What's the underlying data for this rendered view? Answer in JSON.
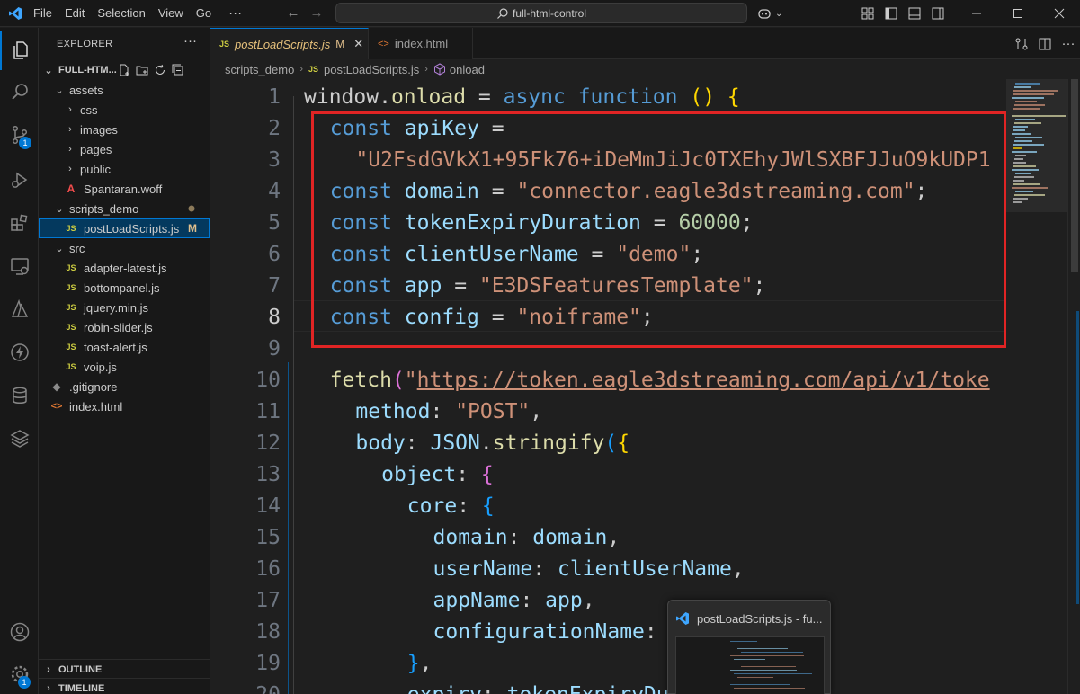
{
  "titlebar": {
    "menu": [
      "File",
      "Edit",
      "Selection",
      "View",
      "Go"
    ],
    "menu_more": "···",
    "search_text": "full-html-control"
  },
  "activitybar": {
    "items": [
      {
        "name": "explorer",
        "badge": ""
      },
      {
        "name": "search",
        "badge": ""
      },
      {
        "name": "source-control",
        "badge": "1"
      },
      {
        "name": "run-debug",
        "badge": ""
      },
      {
        "name": "extensions",
        "badge": ""
      },
      {
        "name": "remote-explorer",
        "badge": ""
      },
      {
        "name": "azure",
        "badge": ""
      },
      {
        "name": "thunder-client",
        "badge": ""
      },
      {
        "name": "database",
        "badge": ""
      },
      {
        "name": "layers",
        "badge": ""
      }
    ],
    "accounts_label": "Accounts",
    "manage_badge": "1"
  },
  "sidebar": {
    "title": "EXPLORER",
    "more": "···",
    "root": "FULL-HTM...",
    "tree": [
      {
        "label": "assets",
        "type": "folder",
        "open": true,
        "indent": 1
      },
      {
        "label": "css",
        "type": "folder",
        "open": false,
        "indent": 2
      },
      {
        "label": "images",
        "type": "folder",
        "open": false,
        "indent": 2
      },
      {
        "label": "pages",
        "type": "folder",
        "open": false,
        "indent": 2
      },
      {
        "label": "public",
        "type": "folder",
        "open": false,
        "indent": 2
      },
      {
        "label": "Spantaran.woff",
        "type": "woff",
        "indent": 2
      },
      {
        "label": "scripts_demo",
        "type": "folder",
        "open": true,
        "indent": 1,
        "status": "dot"
      },
      {
        "label": "postLoadScripts.js",
        "type": "js",
        "indent": 2,
        "status": "M",
        "selected": true
      },
      {
        "label": "src",
        "type": "folder",
        "open": true,
        "indent": 1
      },
      {
        "label": "adapter-latest.js",
        "type": "js",
        "indent": 2
      },
      {
        "label": "bottompanel.js",
        "type": "js",
        "indent": 2
      },
      {
        "label": "jquery.min.js",
        "type": "js",
        "indent": 2
      },
      {
        "label": "robin-slider.js",
        "type": "js",
        "indent": 2
      },
      {
        "label": "toast-alert.js",
        "type": "js",
        "indent": 2
      },
      {
        "label": "voip.js",
        "type": "js",
        "indent": 2
      },
      {
        "label": ".gitignore",
        "type": "git",
        "indent": 1
      },
      {
        "label": "index.html",
        "type": "html",
        "indent": 1
      }
    ],
    "outline": "OUTLINE",
    "timeline": "TIMELINE"
  },
  "tabs": [
    {
      "label": "postLoadScripts.js",
      "icon": "JS",
      "status": "M",
      "active": true
    },
    {
      "label": "index.html",
      "icon": "<>",
      "active": false
    }
  ],
  "breadcrumb": {
    "folder": "scripts_demo",
    "file": "postLoadScripts.js",
    "file_icon": "JS",
    "symbol": "onload"
  },
  "editor": {
    "current_line": 8,
    "lines": [
      {
        "n": "1",
        "indent": 0,
        "tokens": [
          [
            "pl",
            "window"
          ],
          [
            "pl",
            "."
          ],
          [
            "fn",
            "onload"
          ],
          [
            "pl",
            " = "
          ],
          [
            "kw",
            "async"
          ],
          [
            "pl",
            " "
          ],
          [
            "kw",
            "function"
          ],
          [
            "pl",
            " "
          ],
          [
            "br1",
            "()"
          ],
          [
            "pl",
            " "
          ],
          [
            "br1",
            "{"
          ]
        ]
      },
      {
        "n": "2",
        "indent": 1,
        "tokens": [
          [
            "kw",
            "const"
          ],
          [
            "pl",
            " "
          ],
          [
            "var",
            "apiKey"
          ],
          [
            "pl",
            " ="
          ]
        ]
      },
      {
        "n": "3",
        "indent": 2,
        "tokens": [
          [
            "str",
            "\"U2FsdGVkX1+95Fk76+iDeMmJiJc0TXEhyJWlSXBFJJuO9kUDP1"
          ]
        ]
      },
      {
        "n": "4",
        "indent": 1,
        "tokens": [
          [
            "kw",
            "const"
          ],
          [
            "pl",
            " "
          ],
          [
            "var",
            "domain"
          ],
          [
            "pl",
            " = "
          ],
          [
            "str",
            "\"connector.eagle3dstreaming.com\""
          ],
          [
            "pl",
            ";"
          ]
        ]
      },
      {
        "n": "5",
        "indent": 1,
        "tokens": [
          [
            "kw",
            "const"
          ],
          [
            "pl",
            " "
          ],
          [
            "var",
            "tokenExpiryDuration"
          ],
          [
            "pl",
            " = "
          ],
          [
            "num",
            "60000"
          ],
          [
            "pl",
            ";"
          ]
        ]
      },
      {
        "n": "6",
        "indent": 1,
        "tokens": [
          [
            "kw",
            "const"
          ],
          [
            "pl",
            " "
          ],
          [
            "var",
            "clientUserName"
          ],
          [
            "pl",
            " = "
          ],
          [
            "str",
            "\"demo\""
          ],
          [
            "pl",
            ";"
          ]
        ]
      },
      {
        "n": "7",
        "indent": 1,
        "tokens": [
          [
            "kw",
            "const"
          ],
          [
            "pl",
            " "
          ],
          [
            "var",
            "app"
          ],
          [
            "pl",
            " = "
          ],
          [
            "str",
            "\"E3DSFeaturesTemplate\""
          ],
          [
            "pl",
            ";"
          ]
        ]
      },
      {
        "n": "8",
        "indent": 1,
        "tokens": [
          [
            "kw",
            "const"
          ],
          [
            "pl",
            " "
          ],
          [
            "var",
            "config"
          ],
          [
            "pl",
            " = "
          ],
          [
            "str",
            "\"noiframe\""
          ],
          [
            "pl",
            ";"
          ]
        ]
      },
      {
        "n": "9",
        "indent": 0,
        "tokens": []
      },
      {
        "n": "10",
        "indent": 1,
        "tokens": [
          [
            "fn",
            "fetch"
          ],
          [
            "br2",
            "("
          ],
          [
            "str",
            "\""
          ],
          [
            "url",
            "https://token.eagle3dstreaming.com/api/v1/toke"
          ]
        ]
      },
      {
        "n": "11",
        "indent": 2,
        "tokens": [
          [
            "var",
            "method"
          ],
          [
            "pl",
            ": "
          ],
          [
            "str",
            "\"POST\""
          ],
          [
            "pl",
            ","
          ]
        ]
      },
      {
        "n": "12",
        "indent": 2,
        "tokens": [
          [
            "var",
            "body"
          ],
          [
            "pl",
            ": "
          ],
          [
            "var",
            "JSON"
          ],
          [
            "pl",
            "."
          ],
          [
            "fn",
            "stringify"
          ],
          [
            "br3",
            "("
          ],
          [
            "br1",
            "{"
          ]
        ]
      },
      {
        "n": "13",
        "indent": 3,
        "tokens": [
          [
            "var",
            "object"
          ],
          [
            "pl",
            ": "
          ],
          [
            "br2",
            "{"
          ]
        ]
      },
      {
        "n": "14",
        "indent": 4,
        "tokens": [
          [
            "var",
            "core"
          ],
          [
            "pl",
            ": "
          ],
          [
            "br3",
            "{"
          ]
        ]
      },
      {
        "n": "15",
        "indent": 5,
        "tokens": [
          [
            "var",
            "domain"
          ],
          [
            "pl",
            ": "
          ],
          [
            "var",
            "domain"
          ],
          [
            "pl",
            ","
          ]
        ]
      },
      {
        "n": "16",
        "indent": 5,
        "tokens": [
          [
            "var",
            "userName"
          ],
          [
            "pl",
            ": "
          ],
          [
            "var",
            "clientUserName"
          ],
          [
            "pl",
            ","
          ]
        ]
      },
      {
        "n": "17",
        "indent": 5,
        "tokens": [
          [
            "var",
            "appName"
          ],
          [
            "pl",
            ": "
          ],
          [
            "var",
            "app"
          ],
          [
            "pl",
            ","
          ]
        ]
      },
      {
        "n": "18",
        "indent": 5,
        "tokens": [
          [
            "var",
            "configurationName"
          ],
          [
            "pl",
            ": "
          ]
        ]
      },
      {
        "n": "19",
        "indent": 4,
        "tokens": [
          [
            "br3",
            "}"
          ],
          [
            "pl",
            ","
          ]
        ]
      },
      {
        "n": "20",
        "indent": 4,
        "tokens": [
          [
            "var",
            "expiry"
          ],
          [
            "pl",
            ": "
          ],
          [
            "var",
            "tokenExpiryDu"
          ]
        ]
      }
    ]
  },
  "preview": {
    "title": "postLoadScripts.js - fu..."
  },
  "colors": {
    "accent": "#0078d4",
    "highlight_box": "#e02424",
    "modified": "#e2c08d"
  }
}
